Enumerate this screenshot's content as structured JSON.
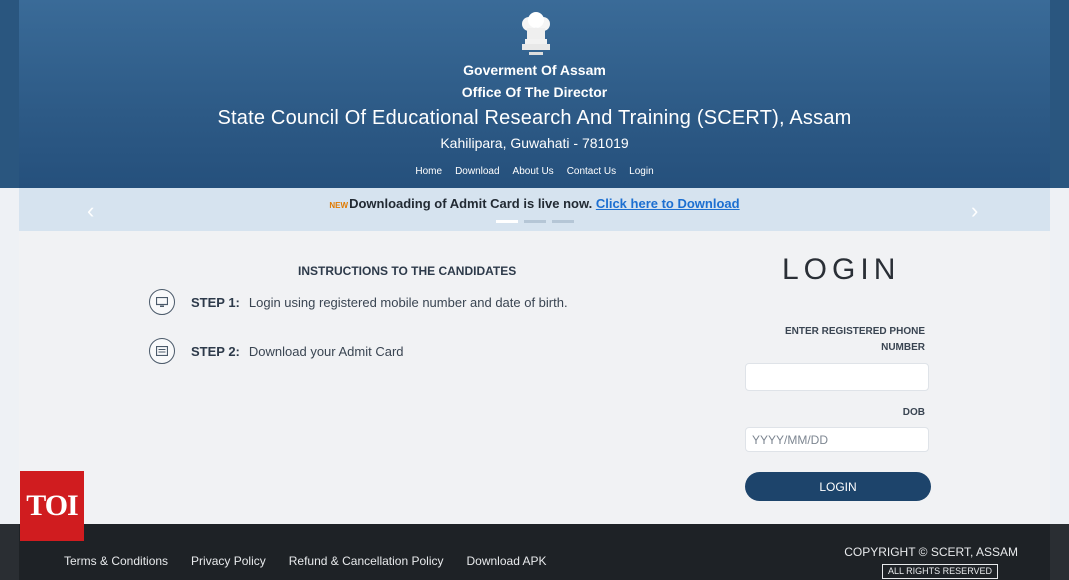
{
  "header": {
    "line1": "Goverment Of Assam",
    "line2": "Office Of The Director",
    "title": "State Council Of Educational Research And Training (SCERT), Assam",
    "address": "Kahilipara, Guwahati - 781019",
    "nav": [
      "Home",
      "Download",
      "About Us",
      "Contact Us",
      "Login"
    ]
  },
  "banner": {
    "new_tag": "NEW",
    "text": "Downloading of Admit Card is live now. ",
    "link": "Click here to Download",
    "prev_arrow": "‹",
    "next_arrow": "›"
  },
  "instructions": {
    "title": "INSTRUCTIONS TO THE CANDIDATES",
    "steps": [
      {
        "label": "STEP 1:",
        "text": "Login using registered mobile number and date of birth.",
        "icon": "monitor-icon"
      },
      {
        "label": "STEP 2:",
        "text": "Download your Admit Card",
        "icon": "document-icon"
      }
    ]
  },
  "login": {
    "title": "LOGIN",
    "phone_label_line1": "ENTER REGISTERED PHONE",
    "phone_label_line2": "NUMBER",
    "phone_value": "",
    "dob_label": "DOB",
    "dob_placeholder": "YYYY/MM/DD",
    "button": "LOGIN"
  },
  "watermark": "TOI",
  "footer": {
    "links": [
      "Terms & Conditions",
      "Privacy Policy",
      "Refund & Cancellation Policy",
      "Download APK"
    ],
    "copyright": "COPYRIGHT © SCERT, ASSAM",
    "rights": "ALL RIGHTS RESERVED"
  },
  "colors": {
    "header": "#2d5a86",
    "banner": "#d6e3ef",
    "link": "#1c6fd1",
    "button": "#1d446b",
    "footer": "#1e2226",
    "logo": "#d01c1f"
  }
}
